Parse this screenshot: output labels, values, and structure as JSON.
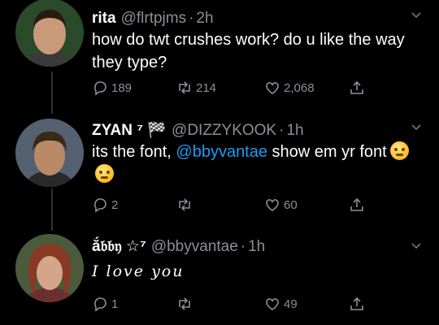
{
  "tweets": [
    {
      "name": "rita",
      "handle": "@flrtpjms",
      "time": "2h",
      "text": "how do twt crushes work? do u like the way they type?",
      "replies": "189",
      "retweets": "214",
      "likes": "2,068"
    },
    {
      "name": "ZYAN ⁷ 🏁",
      "handle": "@DIZZYKOOK",
      "time": "1h",
      "text_pre": "its the font, ",
      "mention": "@bbyvantae",
      "text_post": " show em yr font",
      "replies": "2",
      "retweets": "",
      "likes": "60"
    },
    {
      "name": "ắ𝔟𝔟𝔶 ☆⁷",
      "handle": "@bbyvantae",
      "time": "1h",
      "text": "I love you",
      "replies": "1",
      "retweets": "",
      "likes": "49"
    }
  ],
  "colors": {
    "background": "#000000",
    "muted": "#8b8f94",
    "link": "#1d9bf0"
  },
  "icons": [
    "reply-icon",
    "retweet-icon",
    "like-icon",
    "share-icon",
    "chevron-down-icon"
  ]
}
